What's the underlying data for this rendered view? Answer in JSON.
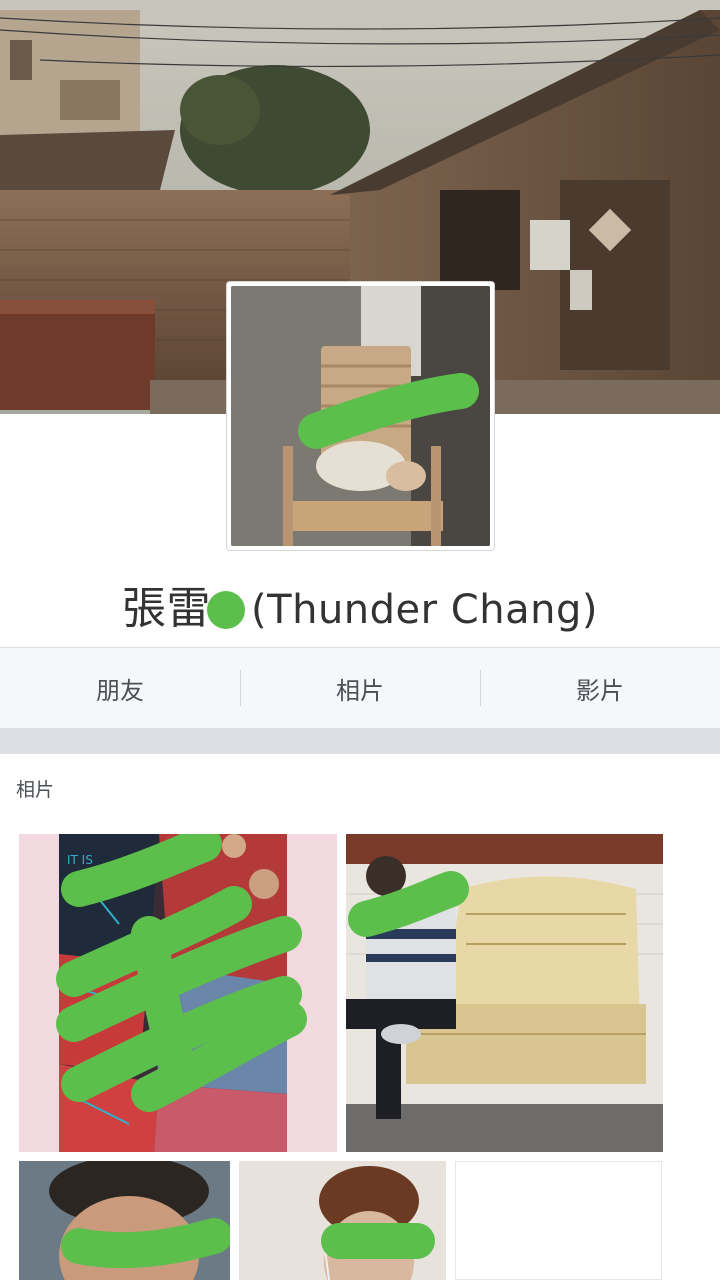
{
  "profile": {
    "name_cn": "張雷",
    "name_en": "(Thunder Chang)"
  },
  "tabs": [
    {
      "label": "朋友"
    },
    {
      "label": "相片"
    },
    {
      "label": "影片"
    }
  ],
  "photos_section": {
    "title": "相片"
  },
  "colors": {
    "redaction_green": "#5cbf4c",
    "tab_bar_bg": "#f6f7f9",
    "divider_gray": "#dcdfe4"
  }
}
